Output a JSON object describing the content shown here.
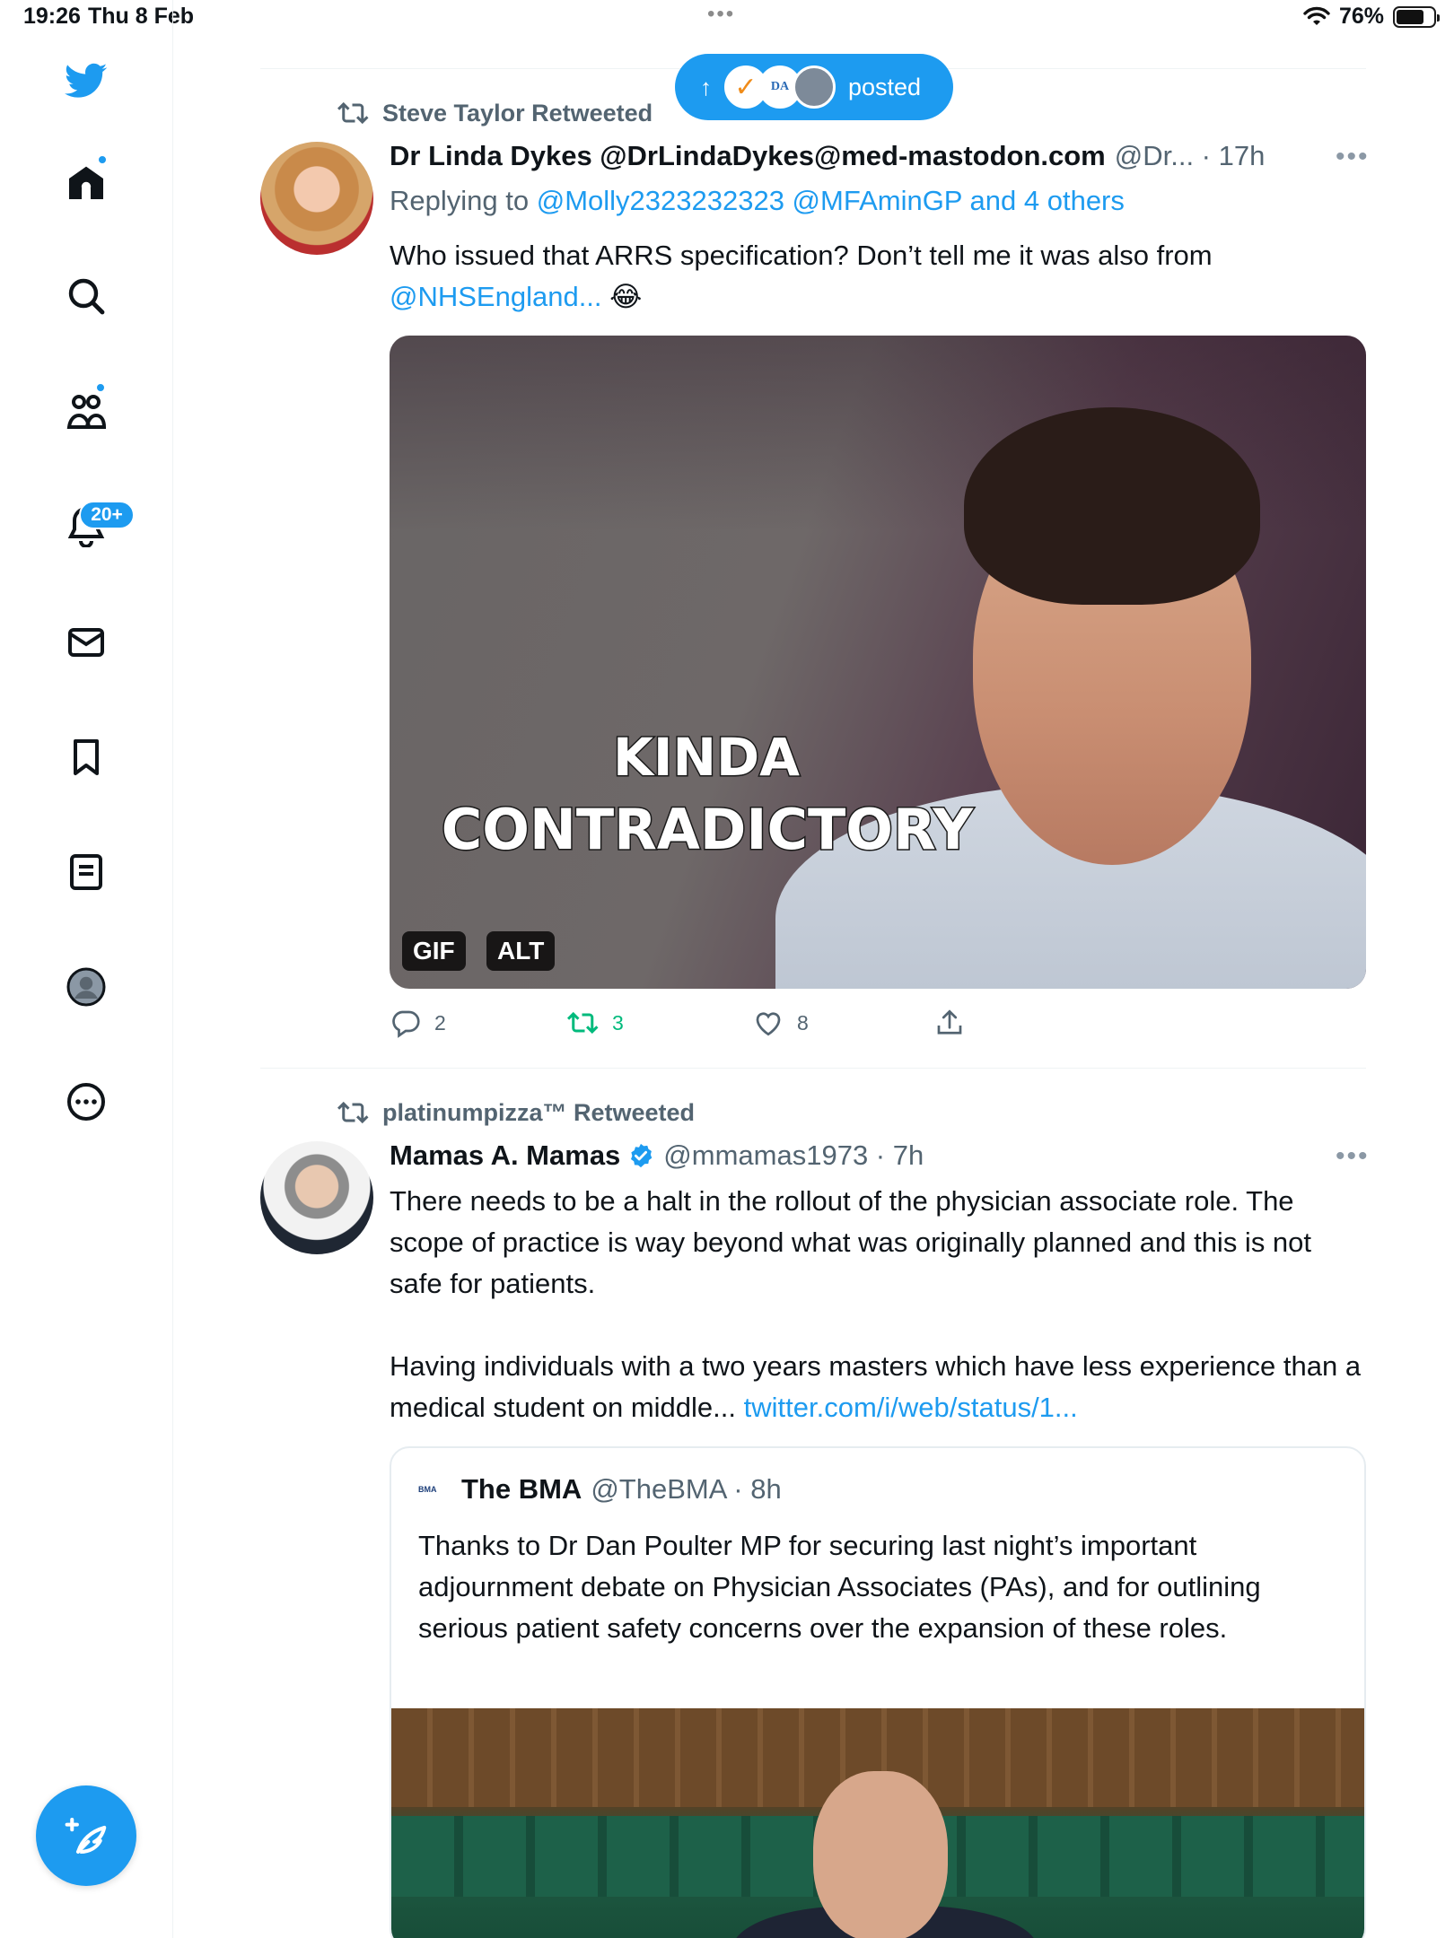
{
  "status_bar": {
    "time": "19:26",
    "date": "Thu 8 Feb",
    "battery": "76%"
  },
  "sidebar": {
    "items": [
      {
        "icon": "twitter-logo-icon"
      },
      {
        "icon": "home-icon"
      },
      {
        "icon": "search-icon"
      },
      {
        "icon": "communities-icon"
      },
      {
        "icon": "bell-icon"
      },
      {
        "icon": "mail-icon"
      },
      {
        "icon": "bookmark-icon"
      },
      {
        "icon": "lists-icon"
      },
      {
        "icon": "profile-icon"
      },
      {
        "icon": "more-icon"
      }
    ],
    "notifications_badge": "20+"
  },
  "posted_pill": {
    "label": "posted",
    "arrow": "↑"
  },
  "colors": {
    "accent": "#1d9bf0",
    "retweet_green": "#00ba7c",
    "muted": "#536471"
  },
  "tweets": [
    {
      "retweeted_by": "Steve Taylor Retweeted",
      "name": "Dr Linda Dykes @DrLindaDykes@med-mastodon.com",
      "handle_time": "@Dr... · 17h",
      "replying_prefix": "Replying to",
      "replying_to": "@Molly2323232323 @MFAminGP and 4 others",
      "text_line1": "Who issued that ARRS specification? Don’t tell me it was also from",
      "text_link": "@NHSEngland...",
      "text_emoji": "😂",
      "media": {
        "caption_line1": "KINDA",
        "caption_line2": "CONTRADICTORY",
        "tag_gif": "GIF",
        "tag_alt": "ALT"
      },
      "counts": {
        "replies": "2",
        "retweets": "3",
        "likes": "8"
      }
    },
    {
      "retweeted_by": "platinumpizza™ Retweeted",
      "name": "Mamas A. Mamas",
      "handle_time": "@mmamas1973 · 7h",
      "paragraph1": "There needs to be a halt in the rollout of the physician associate role. The scope of practice is way beyond what was originally planned and this is not safe for patients.",
      "paragraph2": "Having individuals with a two years masters which have less experience than a medical student on middle...",
      "link": "twitter.com/i/web/status/1...",
      "quote": {
        "logo_text": "BMA",
        "name": "The BMA",
        "handle_time": "@TheBMA · 8h",
        "text": "Thanks to Dr Dan Poulter MP for securing last night’s important adjournment debate on Physician Associates (PAs), and for outlining serious patient safety concerns over the expansion of these roles."
      }
    }
  ]
}
